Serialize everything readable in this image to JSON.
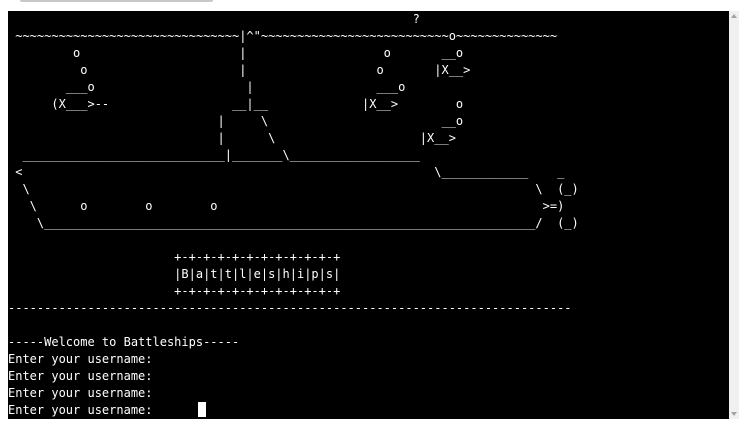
{
  "terminal": {
    "art": [
      "                                                        ?",
      " ~~~~~~~~~~~~~~~~~~~~~~~~~~~~~~~|^\"~~~~~~~~~~~~~~~~~~~~~~~~~~o~~~~~~~~~~~~~~",
      "         o                      |                   o       __o",
      "          o                     |                  o       |X__>",
      "        ___o                     |                 ___o",
      "      (X___>--                 __|__             |X__>        o",
      "                             |     \\                        __o",
      "                             |      \\                    |X__>",
      "  ____________________________|_______\\__________________",
      " <                                                         \\____________    _",
      "  \\                                                                      \\  (_)",
      "   \\      o        o        o                                             >=)",
      "    \\____________________________________________________________________/  (_)",
      "",
      "                       +-+-+-+-+-+-+-+-+-+-+-+",
      "                       |B|a|t|t|l|e|s|h|i|p|s|",
      "                       +-+-+-+-+-+-+-+-+-+-+-+",
      "------------------------------------------------------------------------------",
      "",
      "-----Welcome to Battleships-----"
    ],
    "prompts": [
      "Enter your username:",
      "Enter your username:",
      "Enter your username:",
      "Enter your username: "
    ]
  }
}
